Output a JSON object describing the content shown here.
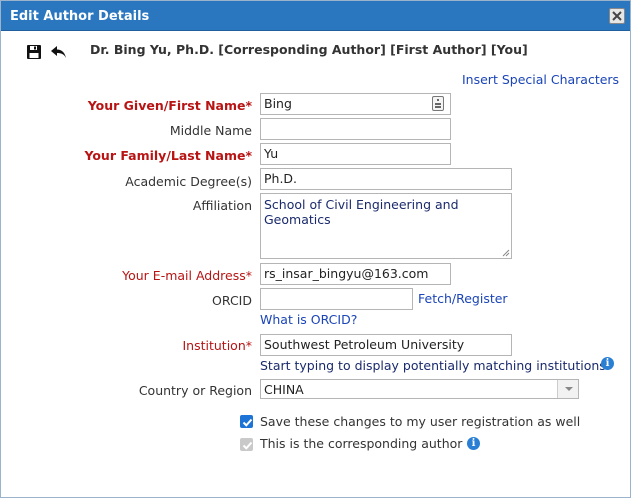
{
  "dialog": {
    "title": "Edit Author Details",
    "header": "Dr. Bing Yu, Ph.D. [Corresponding Author] [First Author] [You]",
    "insert_special_characters": "Insert Special Characters"
  },
  "form": {
    "given_name": {
      "label": "Your Given/First Name*",
      "value": "Bing"
    },
    "middle_name": {
      "label": "Middle Name",
      "value": ""
    },
    "family_name": {
      "label": "Your Family/Last Name*",
      "value": "Yu"
    },
    "degree": {
      "label": "Academic Degree(s)",
      "value": "Ph.D."
    },
    "affiliation": {
      "label": "Affiliation",
      "value": "School of Civil Engineering and Geomatics"
    },
    "email": {
      "label": "Your E-mail Address*",
      "value": "rs_insar_bingyu@163.com"
    },
    "orcid": {
      "label": "ORCID",
      "value": "",
      "fetch_link": "Fetch/Register",
      "what_link": "What is ORCID?"
    },
    "institution": {
      "label": "Institution*",
      "value": "Southwest Petroleum University",
      "hint": "Start typing to display potentially matching institutions."
    },
    "country": {
      "label": "Country or Region",
      "value": "CHINA"
    },
    "save_changes": {
      "label": "Save these changes to my user registration as well",
      "checked": true
    },
    "corresponding": {
      "label": "This is the corresponding author",
      "checked": true,
      "disabled": true
    }
  },
  "icons": {
    "save": "floppy-disk-icon",
    "undo": "undo-arrow-icon",
    "close": "close-icon",
    "info": "info-icon"
  },
  "colors": {
    "titlebar": "#2a77c0",
    "required_label": "#b81414",
    "link": "#1a44b8",
    "checkbox": "#1e74d6"
  }
}
